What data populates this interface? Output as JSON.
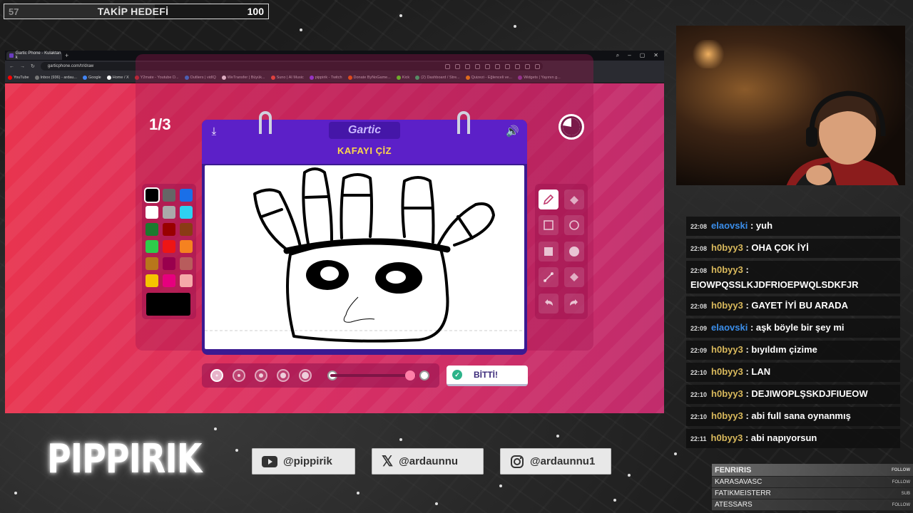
{
  "goal": {
    "current": "57",
    "title": "TAKİP HEDEFİ",
    "target": "100",
    "progress_fraction": 0.57
  },
  "browser": {
    "tab_title": "Gartic Phone - Kulaktan k",
    "url": "garticphone.com/tr/draw",
    "bookmarks": [
      "YouTube",
      "Inbox (936) - ardau...",
      "Google",
      "Home / X",
      "Y2mate - Youtube D...",
      "Outliers | vidIQ",
      "WeTransfer | Büyük...",
      "Suno | AI Music",
      "pippirik - Twitch",
      "Donate ByNoGame...",
      "Kick",
      "(2) Dashboard / Stre...",
      "Quizezi - Eğlenceli ve...",
      "Widgets | Yayının g..."
    ]
  },
  "game": {
    "round": "1/3",
    "logo": "Gartic",
    "prompt": "KAFAYI ÇİZ",
    "done_label": "BİTTİ!",
    "palette": [
      "#000000",
      "#666666",
      "#1a6fe8",
      "#ffffff",
      "#aaaaaa",
      "#2ed1f0",
      "#1c7a2e",
      "#990000",
      "#8a3b14",
      "#2ecc4a",
      "#ee1515",
      "#f58220",
      "#b8761c",
      "#99004d",
      "#b85c5c",
      "#f5c400",
      "#e6007e",
      "#f5a9a9"
    ],
    "selected_color": "#000000",
    "tools": [
      "pencil-icon",
      "eraser-icon",
      "rect-outline-icon",
      "circle-outline-icon",
      "rect-fill-icon",
      "circle-fill-icon",
      "line-icon",
      "fill-bucket-icon",
      "undo-icon",
      "redo-icon"
    ],
    "brush_sizes": 5,
    "selected_brush": 0,
    "opacity_fraction": 0.85
  },
  "chat": [
    {
      "time": "22:08",
      "user": "elaovski",
      "color": "blue",
      "text": "yuh"
    },
    {
      "time": "22:08",
      "user": "h0byy3",
      "color": "gold",
      "text": "OHA ÇOK İYİ"
    },
    {
      "time": "22:08",
      "user": "h0byy3",
      "color": "gold",
      "text": "EIOWPQSSLKJDFRIOEPWQLSDKFJR"
    },
    {
      "time": "22:08",
      "user": "h0byy3",
      "color": "gold",
      "text": "GAYET İYİ BU ARADA"
    },
    {
      "time": "22:09",
      "user": "elaovski",
      "color": "blue",
      "text": "aşk böyle bir şey mi"
    },
    {
      "time": "22:09",
      "user": "h0byy3",
      "color": "gold",
      "text": "bıyıldım çizime"
    },
    {
      "time": "22:10",
      "user": "h0byy3",
      "color": "gold",
      "text": "LAN"
    },
    {
      "time": "22:10",
      "user": "h0byy3",
      "color": "gold",
      "text": "DEJIWOPLŞSKDJFIUEOW"
    },
    {
      "time": "22:10",
      "user": "h0byy3",
      "color": "gold",
      "text": "abi full sana oynanmış"
    },
    {
      "time": "22:11",
      "user": "h0byy3",
      "color": "gold",
      "text": "abi napıyorsun"
    }
  ],
  "brand": "PIPPIRIK",
  "socials": [
    {
      "icon": "youtube-icon",
      "handle": "@pippirik"
    },
    {
      "icon": "x-icon",
      "handle": "@ardaunnu"
    },
    {
      "icon": "instagram-icon",
      "handle": "@ardaunnu1"
    }
  ],
  "followers": [
    {
      "name": "FENRIRIS",
      "tag": "FOLLOW"
    },
    {
      "name": "KARASAVASC",
      "tag": "FOLLOW"
    },
    {
      "name": "FATIKMEISTERR",
      "tag": "SUB"
    },
    {
      "name": "ATESSARS",
      "tag": "FOLLOW"
    }
  ]
}
